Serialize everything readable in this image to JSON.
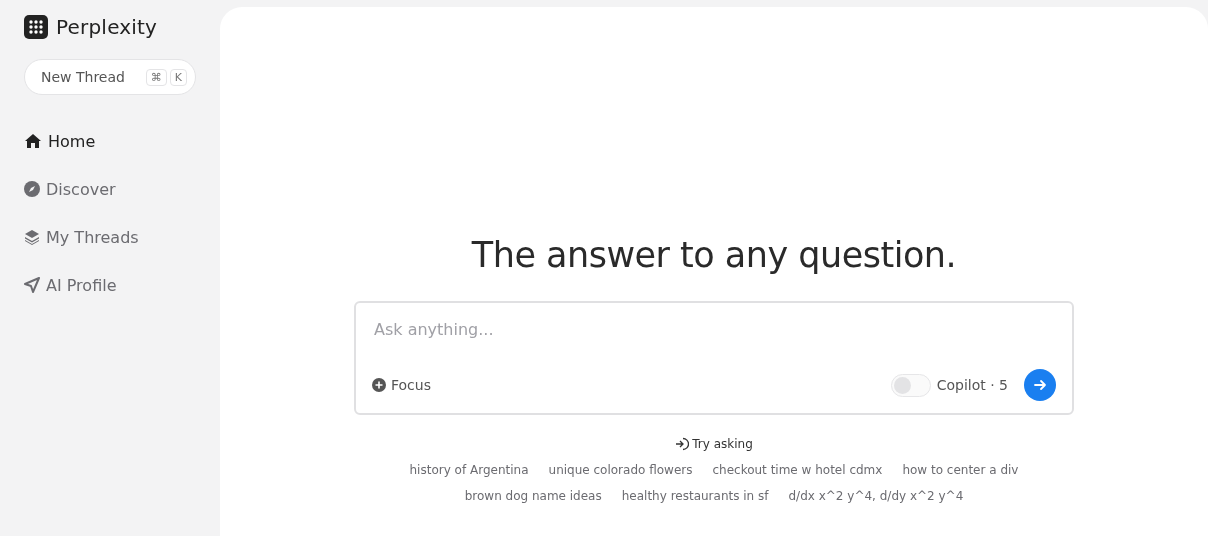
{
  "brand": {
    "name": "Perplexity"
  },
  "new_thread": {
    "label": "New Thread",
    "keys": [
      "⌘",
      "K"
    ]
  },
  "nav": [
    {
      "kind": "home",
      "label": "Home",
      "selected": true
    },
    {
      "kind": "discover",
      "label": "Discover",
      "selected": false
    },
    {
      "kind": "threads",
      "label": "My Threads",
      "selected": false
    },
    {
      "kind": "profile",
      "label": "AI Profile",
      "selected": false
    }
  ],
  "headline": "The answer to any question.",
  "search": {
    "placeholder": "Ask anything...",
    "focus_label": "Focus",
    "copilot": {
      "on": false,
      "label": "Copilot · 5"
    }
  },
  "try_asking": {
    "label": "Try asking",
    "suggestions": [
      [
        "history of Argentina",
        "unique colorado flowers",
        "checkout time w hotel cdmx",
        "how to center a div"
      ],
      [
        "brown dog name ideas",
        "healthy restaurants in sf",
        "d/dx x^2 y^4, d/dy x^2 y^4"
      ]
    ]
  }
}
